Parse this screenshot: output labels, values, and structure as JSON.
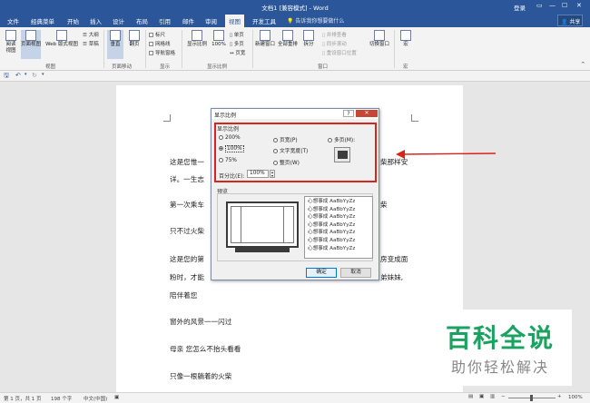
{
  "window": {
    "title": "文档1 [兼容模式] - Word",
    "login": "登录",
    "share": "共享",
    "tell_me": "告诉我你想要做什么",
    "buttons": [
      "▭",
      "—",
      "☐",
      "✕"
    ]
  },
  "tabs": [
    {
      "label": "文件"
    },
    {
      "label": "经典菜单"
    },
    {
      "label": "开始"
    },
    {
      "label": "插入"
    },
    {
      "label": "设计"
    },
    {
      "label": "布局"
    },
    {
      "label": "引用"
    },
    {
      "label": "邮件"
    },
    {
      "label": "审阅"
    },
    {
      "label": "视图",
      "active": true
    },
    {
      "label": "开发工具"
    }
  ],
  "ribbon": {
    "views": {
      "read": "阅读视图",
      "print": "页面视图",
      "web": "Web 版式视图",
      "outline": "大纲",
      "draft": "草稿",
      "group": "视图"
    },
    "movement": {
      "vertical": "垂直",
      "side": "翻页",
      "group": "页面移动"
    },
    "show": {
      "ruler": "标尺",
      "gridlines": "网格线",
      "nav": "导航窗格",
      "group": "显示"
    },
    "zoom": {
      "zoom": "显示比例",
      "hundred": "100%",
      "one_page": "单页",
      "multi_page": "多页",
      "page_width": "页宽",
      "group": "显示比例"
    },
    "window": {
      "new": "新建窗口",
      "arrange": "全部重排",
      "split": "拆分",
      "side_by_side": "并排查看",
      "sync": "同步滚动",
      "reset": "重设窗口位置",
      "switch": "切换窗口",
      "group": "窗口"
    },
    "macro": {
      "label": "宏",
      "group": "宏"
    }
  },
  "document": {
    "lines": [
      "这是您惟一",
      "详。一生志",
      "第一次乘车",
      "只不过火柴",
      "这是您的第",
      "粉时，才能",
      "陪伴着您",
      "窗外的风景一一闪过",
      "母亲 您怎么不抬头看看",
      "只像一根躺着的火柴"
    ],
    "right_fragments": [
      "柴那样安",
      "柴",
      "房变成面",
      "弟妹妹,"
    ]
  },
  "dialog": {
    "title": "显示比例",
    "help": "?",
    "close": "✕",
    "zoom_section": "显示比例",
    "options": [
      {
        "label": "200%",
        "checked": false
      },
      {
        "label": "100%",
        "checked": true
      },
      {
        "label": "75%",
        "checked": false
      },
      {
        "label": "页宽(P)",
        "checked": false
      },
      {
        "label": "文字宽度(T)",
        "checked": false
      },
      {
        "label": "整页(W)",
        "checked": false
      },
      {
        "label": "多页(M):",
        "checked": false
      }
    ],
    "percent_label": "百分比(E):",
    "percent_value": "100%",
    "preview_label": "预览",
    "preview_lines": [
      "心想事成 AaBbYyZz",
      "心想事成 AaBbYyZz",
      "心想事成 AaBbYyZz",
      "心想事成 AaBbYyZz",
      "心想事成 AaBbYyZz",
      "心想事成 AaBbYyZz",
      "心想事成 AaBbYyZz"
    ],
    "ok": "确定",
    "cancel": "取消"
  },
  "status": {
    "page": "第 1 页，共 1 页",
    "words": "198 个字",
    "lang": "中文(中国)",
    "zoom": "100%"
  },
  "watermark": {
    "title": "百科全说",
    "subtitle": "助你轻松解决"
  },
  "colors": {
    "accent": "#2b579a",
    "highlight": "#d9231f",
    "watermark": "#1aa260"
  }
}
